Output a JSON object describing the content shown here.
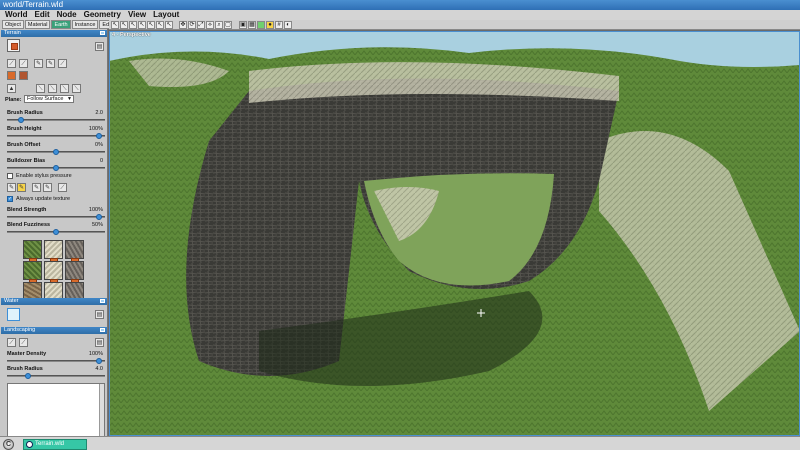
{
  "window": {
    "title": "world/Terrain.wld"
  },
  "menu": [
    "World",
    "Edit",
    "Node",
    "Geometry",
    "View",
    "Layout"
  ],
  "tabs": [
    {
      "label": "Object",
      "active": false
    },
    {
      "label": "Material",
      "active": false
    },
    {
      "label": "Earth",
      "active": true
    },
    {
      "label": "Instance",
      "active": false
    },
    {
      "label": "Editor",
      "active": false
    }
  ],
  "terrain_section": {
    "title": "Terrain",
    "plane_label": "Plane:",
    "plane_value": "Follow Surface",
    "params": [
      {
        "label": "Brush Radius",
        "value": "2.0",
        "level": 0.12
      },
      {
        "label": "Brush Height",
        "value": "100%",
        "level": 0.97
      },
      {
        "label": "Brush Offset",
        "value": "0%",
        "level": 0.5
      },
      {
        "label": "Bulldozer Bias",
        "value": "0",
        "level": 0.5
      }
    ],
    "stylus_label": "Enable stylus pressure",
    "stylus_checked": false,
    "update_label": "Always update texture",
    "update_checked": true,
    "blend_params": [
      {
        "label": "Blend Strength",
        "value": "100%",
        "level": 0.97
      },
      {
        "label": "Blend Fuzziness",
        "value": "50%",
        "level": 0.5
      }
    ],
    "textures": [
      "grass",
      "stone",
      "rock",
      "grass",
      "stone",
      "rock",
      "dirt",
      "stone",
      "rock"
    ]
  },
  "water_section": {
    "title": "Water"
  },
  "landscaping_section": {
    "title": "Landscaping",
    "params": [
      {
        "label": "Master Density",
        "value": "100%",
        "level": 0.97
      },
      {
        "label": "Brush Radius",
        "value": "4.0",
        "level": 0.2
      }
    ]
  },
  "viewport": {
    "label": "4 - Perspective"
  },
  "taskbar": {
    "item": "Terrain.wld"
  },
  "colors": {
    "accent": "#3f86c7",
    "active_tab": "#3aa07a",
    "task": "#36c7a6"
  }
}
